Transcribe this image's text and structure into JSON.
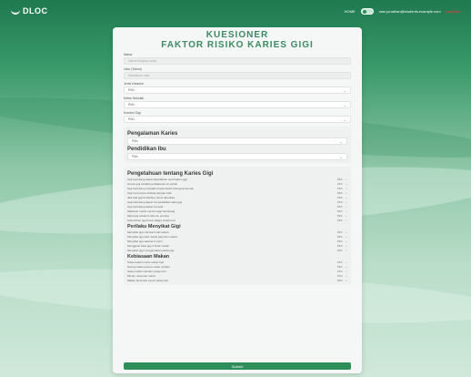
{
  "header": {
    "logo_text": "DLOC",
    "nav_home": "HOME",
    "email": "user.jonathan@students.example.com",
    "logout": "Log Out"
  },
  "form": {
    "title_line1": "KUESIONER",
    "title_line2": "FAKTOR RISIKO KARIES GIGI",
    "fields": [
      {
        "label": "Nama",
        "placeholder": "Nama lengkap anak",
        "type": "input"
      },
      {
        "label": "Usia (Tahun)",
        "placeholder": "Masukkan usia",
        "type": "input"
      },
      {
        "label": "Jenis Kelamin",
        "value": "Pilih",
        "type": "select"
      },
      {
        "label": "Kelas Sekolah",
        "value": "Pilih",
        "type": "select"
      },
      {
        "label": "Kondisi Gigi",
        "value": "Pilih",
        "type": "select"
      }
    ],
    "pengalaman": {
      "title": "Pengalaman Karies",
      "value": "Pilih"
    },
    "pendidikan": {
      "title": "Pendidikan Ibu",
      "value": "Pilih"
    },
    "pengetahuan": {
      "title": "Pengetahuan tentang Karies Gigi",
      "questions": [
        "Gigi berlubang dapat disebabkan oleh bakteri gigi",
        "Gosok gigi sebaiknya dilakukan 2x sehari",
        "Gigi berlubang menjadi tempat berkembangnya kuman",
        "Gigi susu harus dirawat dengan baik",
        "Jika ada gigi berlubang harus diperiksa",
        "Gigi berlubang dapat menyebabkan sakit gigi",
        "Gigi berlubang dapat menular",
        "Makanan manis memicu gigi berlubang",
        "Sikat gigi sebelum tidur itu penting",
        "Kebersihan gigi harus dijaga setiap hari"
      ],
      "answer": "Pilih"
    },
    "perilaku": {
      "title": "Perilaku Menyikat Gigi",
      "questions": [
        "Menyikat gigi minimal 2 kali sehari",
        "Menyikat gigi saat mandi pagi dan malam",
        "Menyikat gigi selama 2 menit",
        "Mengganti sikat gigi 3 bulan sekali",
        "Menyikat gigi menggunakan pasta gigi"
      ],
      "answer": "Pilih"
    },
    "kebiasaan": {
      "title": "Kebiasaan Makan",
      "questions": [
        "Suka makan manis setiap hari",
        "Sering makan permen atau cokelat",
        "Suka makan camilan setiap hari",
        "Minum minuman manis",
        "Makan buah dan sayur setiap hari"
      ],
      "answer": "Pilih"
    },
    "submit_label": "Submit"
  }
}
